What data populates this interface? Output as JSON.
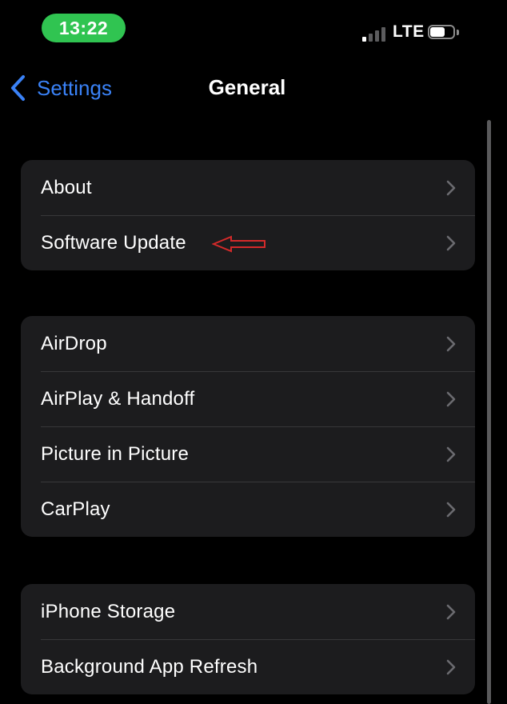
{
  "status_bar": {
    "time": "13:22",
    "network": "LTE",
    "signal_bars_active": 1,
    "signal_bars_total": 4,
    "battery_level": 0.65
  },
  "nav": {
    "back_label": "Settings",
    "title": "General"
  },
  "groups": [
    {
      "items": [
        {
          "label": "About"
        },
        {
          "label": "Software Update"
        }
      ]
    },
    {
      "items": [
        {
          "label": "AirDrop"
        },
        {
          "label": "AirPlay & Handoff"
        },
        {
          "label": "Picture in Picture"
        },
        {
          "label": "CarPlay"
        }
      ]
    },
    {
      "items": [
        {
          "label": "iPhone Storage"
        },
        {
          "label": "Background App Refresh"
        }
      ]
    }
  ],
  "colors": {
    "background": "#000000",
    "cell": "#1c1c1e",
    "separator": "#38383a",
    "accent": "#3a82f7",
    "time_pill": "#30c451",
    "chevron": "#6b6b70",
    "annotation": "#d42a2a"
  },
  "icons": {
    "back": "chevron-left-icon",
    "row": "chevron-right-icon",
    "annotation": "arrow-left-outline-icon"
  }
}
